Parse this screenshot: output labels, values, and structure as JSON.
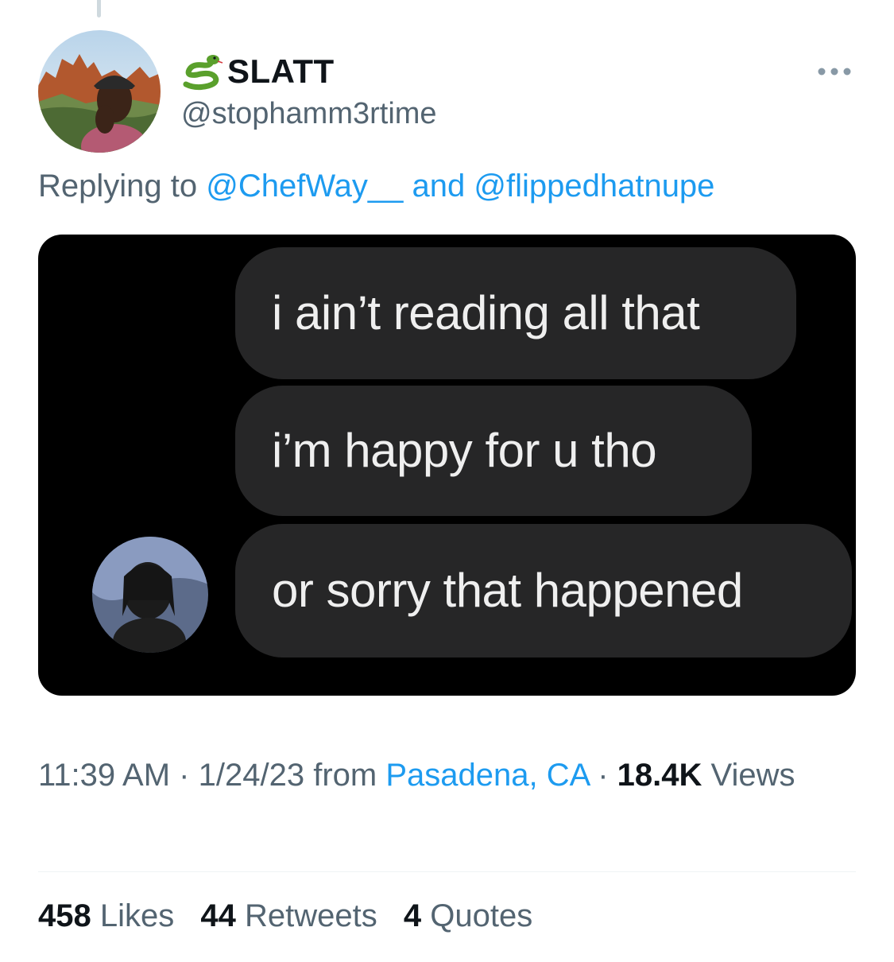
{
  "author": {
    "display_name": "SLATT",
    "name_emoji": "snake-icon",
    "handle": "@stophamm3rtime"
  },
  "reply": {
    "prefix": "Replying to",
    "mention_1": "@ChefWay__",
    "conjunction": "and",
    "mention_2": "@flippedhatnupe"
  },
  "media": {
    "messages": [
      "i ain’t reading all that",
      "i’m happy for u tho",
      "or sorry that happened"
    ]
  },
  "meta": {
    "time": "11:39 AM",
    "sep": "·",
    "date": "1/24/23",
    "from": "from",
    "location": "Pasadena, CA",
    "views_count": "18.4K",
    "views_label": "Views"
  },
  "stats": {
    "likes_count": "458",
    "likes_label": "Likes",
    "retweets_count": "44",
    "retweets_label": "Retweets",
    "quotes_count": "4",
    "quotes_label": "Quotes"
  },
  "colors": {
    "accent": "#1d9bf0",
    "secondary_text": "#536471",
    "primary_text": "#0f1419",
    "bubble": "#262627"
  }
}
